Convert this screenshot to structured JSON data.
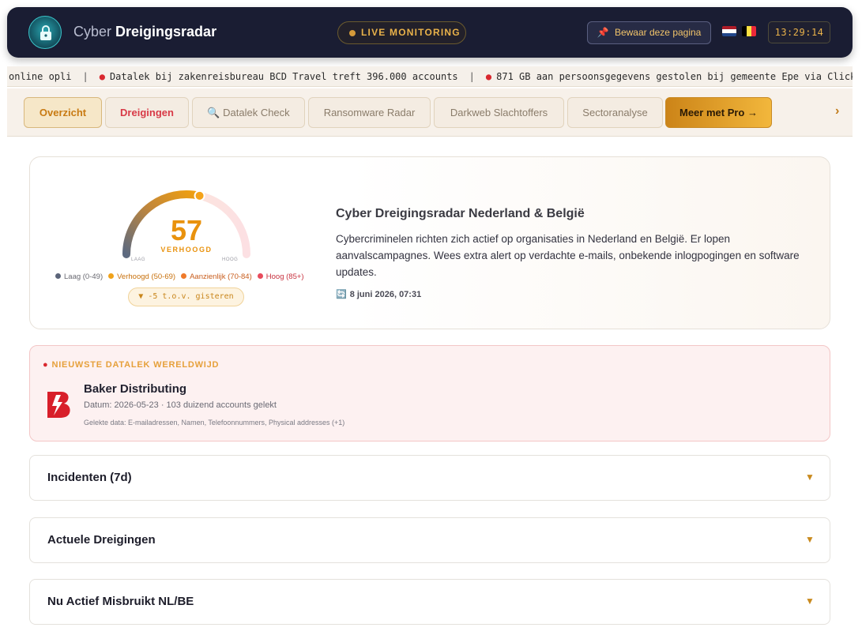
{
  "header": {
    "brand_light": "Cyber",
    "brand_bold": "Dreigingsradar",
    "live_label": "LIVE MONITORING",
    "save_label": "Bewaar deze pagina",
    "clock": "13:29:14"
  },
  "ticker": {
    "items": [
      "online opli",
      "Datalek bij zakenreisbureau BCD Travel treft 396.000 accounts",
      "871 GB aan persoonsgegevens gestolen bij gemeente Epe via ClickFi"
    ]
  },
  "nav": {
    "tabs": [
      {
        "label": "Overzicht"
      },
      {
        "label": "Dreigingen"
      },
      {
        "label": "🔍 Datalek Check"
      },
      {
        "label": "Ransomware Radar"
      },
      {
        "label": "Darkweb Slachtoffers"
      },
      {
        "label": "Sectoranalyse"
      },
      {
        "label": "Meer met Pro →"
      }
    ],
    "more": "›"
  },
  "threat": {
    "score": "57",
    "score_value": 57,
    "score_max": 100,
    "level": "VERHOOGD",
    "gauge_min": "LAAG",
    "gauge_max": "HOOG",
    "legend": [
      {
        "label": "Laag (0-49)",
        "color": "#5b6479"
      },
      {
        "label": "Verhoogd (50-69)",
        "color": "#f0a21a"
      },
      {
        "label": "Aanzienlijk (70-84)",
        "color": "#ef7a2b"
      },
      {
        "label": "Hoog (85+)",
        "color": "#e84b5c"
      }
    ],
    "trend": "▼ -5 t.o.v. gisteren",
    "title": "Cyber Dreigingsradar Nederland & België",
    "description": "Cybercriminelen richten zich actief op organisaties in Nederland en België. Er lopen aanvalscampagnes. Wees extra alert op verdachte e-mails, onbekende inlogpogingen en software updates.",
    "updated": "8 juni 2026, 07:31"
  },
  "breach": {
    "heading": "NIEUWSTE DATALEK WERELDWIJD",
    "name": "Baker Distributing",
    "meta": "Datum: 2026-05-23 · 103 duizend accounts gelekt",
    "data": "Gelekte data: E-mailadressen, Namen, Telefoonnummers, Physical addresses (+1)"
  },
  "sections": [
    {
      "title": "Incidenten (7d)"
    },
    {
      "title": "Actuele Dreigingen"
    },
    {
      "title": "Nu Actief Misbruikt NL/BE"
    }
  ],
  "colors": {
    "accent": "#e9920d",
    "header_bg": "#1a1d33",
    "danger": "#d9282f"
  }
}
